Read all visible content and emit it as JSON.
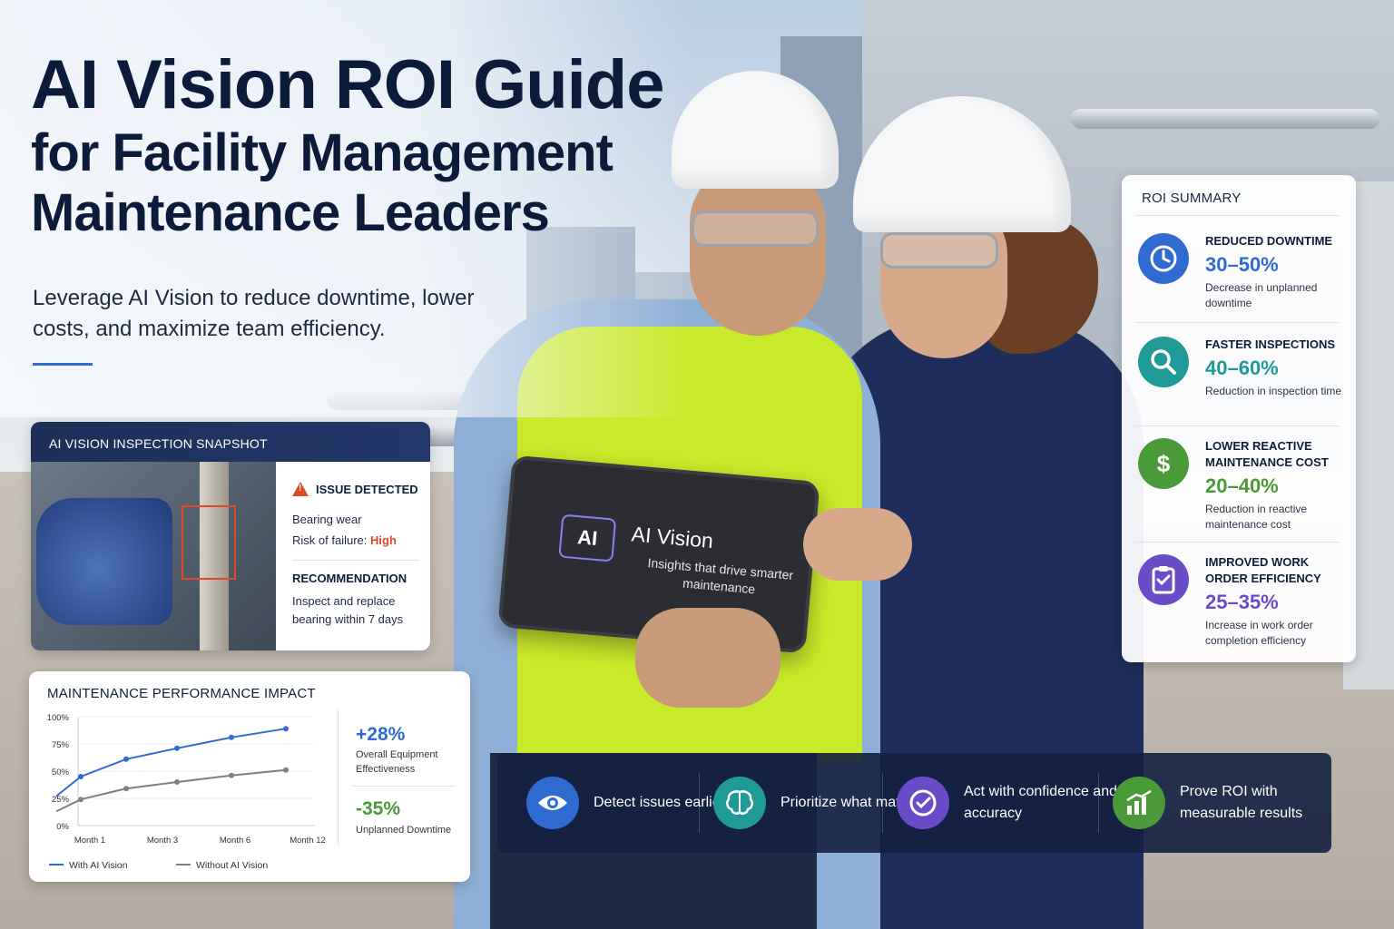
{
  "header": {
    "title_line1": "AI Vision ROI Guide",
    "title_line2": "for Facility Management",
    "title_line3": "Maintenance Leaders",
    "subtitle": "Leverage AI Vision to reduce downtime, lower costs, and maximize team efficiency."
  },
  "colors": {
    "navy": "#0d1b3a",
    "blue": "#2f6bd1",
    "teal": "#1f9a96",
    "green": "#4a9a3a",
    "purple": "#6a4cc9",
    "alert_red": "#d9482b"
  },
  "tablet": {
    "logo": "AI",
    "title": "AI Vision",
    "tagline": "Insights that drive smarter maintenance"
  },
  "snapshot": {
    "title": "AI VISION INSPECTION SNAPSHOT",
    "issue_label": "ISSUE DETECTED",
    "issue_icon": "warning-icon",
    "issue_name": "Bearing wear",
    "risk_label": "Risk of failure:",
    "risk_value": "High",
    "rec_label": "RECOMMENDATION",
    "rec_text": "Inspect and replace bearing within 7 days"
  },
  "performance": {
    "title": "MAINTENANCE PERFORMANCE IMPACT",
    "stat1_value": "+28%",
    "stat1_label": "Overall Equipment Effectiveness",
    "stat2_value": "-35%",
    "stat2_label": "Unplanned Downtime"
  },
  "chart_data": {
    "type": "line",
    "title": "MAINTENANCE PERFORMANCE IMPACT",
    "x_tick_labels": [
      "Month 1",
      "Month 3",
      "Month 6",
      "Month 12"
    ],
    "y_tick_labels": [
      "0%",
      "25%",
      "50%",
      "75%",
      "100%"
    ],
    "ylim": [
      0,
      100
    ],
    "grid": true,
    "legend": "bottom",
    "series": [
      {
        "name": "With AI Vision",
        "color": "#2f6bd1",
        "values": [
          27,
          45,
          61,
          71,
          81,
          89
        ]
      },
      {
        "name": "Without AI Vision",
        "color": "#7a7f88",
        "values": [
          13,
          24,
          34,
          40,
          46,
          51
        ]
      }
    ]
  },
  "roi": {
    "title": "ROI SUMMARY",
    "items": [
      {
        "heading": "REDUCED DOWNTIME",
        "value": "30–50%",
        "desc": "Decrease in unplanned downtime",
        "icon": "clock-icon",
        "color": "#2f6bd1"
      },
      {
        "heading": "FASTER INSPECTIONS",
        "value": "40–60%",
        "desc": "Reduction in inspection time",
        "icon": "magnifier-icon",
        "color": "#1f9a96"
      },
      {
        "heading": "LOWER REACTIVE MAINTENANCE COST",
        "value": "20–40%",
        "desc": "Reduction in reactive maintenance cost",
        "icon": "dollar-icon",
        "color": "#4a9a3a"
      },
      {
        "heading": "IMPROVED WORK ORDER EFFICIENCY",
        "value": "25–35%",
        "desc": "Increase in work order completion efficiency",
        "icon": "clipboard-icon",
        "color": "#6a4cc9"
      }
    ]
  },
  "benefits": [
    {
      "text": "Detect issues earlier",
      "icon": "eye-icon",
      "color": "#2f6bd1"
    },
    {
      "text": "Prioritize what matters",
      "icon": "brain-icon",
      "color": "#1f9a96"
    },
    {
      "text": "Act with confidence and accuracy",
      "icon": "check-icon",
      "color": "#6a4cc9"
    },
    {
      "text": "Prove ROI with measurable results",
      "icon": "bar-chart-icon",
      "color": "#4a9a3a"
    }
  ]
}
